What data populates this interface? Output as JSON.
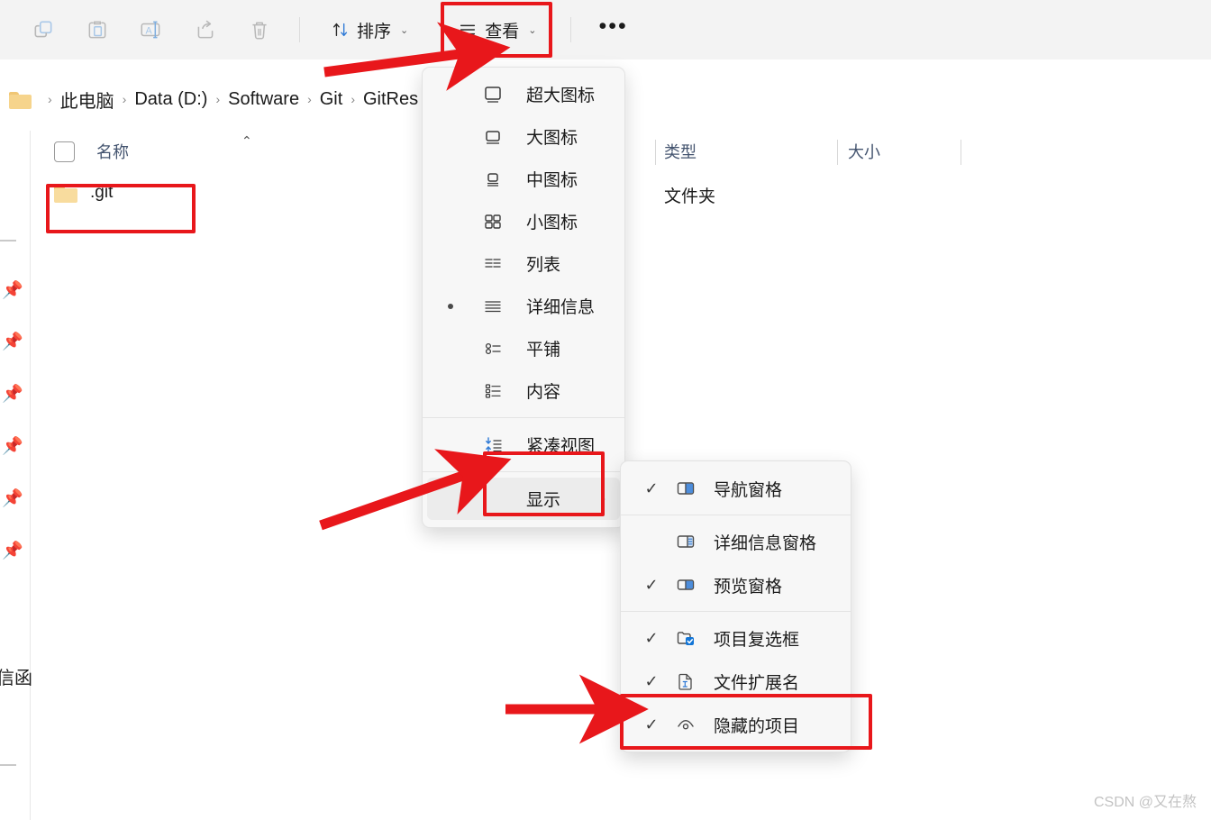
{
  "toolbar": {
    "icons": [
      {
        "name": "copy-icon",
        "glyph": "copy"
      },
      {
        "name": "paste-icon",
        "glyph": "paste"
      },
      {
        "name": "rename-icon",
        "glyph": "rename"
      },
      {
        "name": "share-icon",
        "glyph": "share"
      },
      {
        "name": "delete-icon",
        "glyph": "trash"
      }
    ],
    "sort_label": "排序",
    "view_label": "查看",
    "more_label": "•••",
    "chevron": "⌄"
  },
  "breadcrumb": {
    "separator": "›",
    "items": [
      "此电脑",
      "Data (D:)",
      "Software",
      "Git",
      "GitRes"
    ]
  },
  "columns": {
    "name": "名称",
    "type": "类型",
    "size": "大小",
    "sort_caret": "⌃"
  },
  "files": [
    {
      "name": ".git",
      "type": "文件夹",
      "size": ""
    }
  ],
  "view_menu": {
    "items": [
      {
        "label": "超大图标",
        "icon": "extra-large-icons-icon",
        "selected": false
      },
      {
        "label": "大图标",
        "icon": "large-icons-icon",
        "selected": false
      },
      {
        "label": "中图标",
        "icon": "medium-icons-icon",
        "selected": false
      },
      {
        "label": "小图标",
        "icon": "small-icons-icon",
        "selected": false
      },
      {
        "label": "列表",
        "icon": "list-icon",
        "selected": false
      },
      {
        "label": "详细信息",
        "icon": "details-icon",
        "selected": true
      },
      {
        "label": "平铺",
        "icon": "tiles-icon",
        "selected": false
      },
      {
        "label": "内容",
        "icon": "content-icon",
        "selected": false
      }
    ],
    "compact_label": "紧凑视图",
    "compact_icon": "compact-view-icon",
    "show_label": "显示",
    "show_chevron": "›"
  },
  "display_submenu": {
    "groups": [
      [
        {
          "label": "导航窗格",
          "icon": "navigation-pane-icon",
          "checked": true
        },
        {
          "label": "详细信息窗格",
          "icon": "details-pane-icon",
          "checked": false
        },
        {
          "label": "预览窗格",
          "icon": "preview-pane-icon",
          "checked": true
        }
      ],
      [
        {
          "label": "项目复选框",
          "icon": "item-checkboxes-icon",
          "checked": true
        },
        {
          "label": "文件扩展名",
          "icon": "file-extensions-icon",
          "checked": true
        },
        {
          "label": "隐藏的项目",
          "icon": "hidden-items-icon",
          "checked": true
        }
      ]
    ],
    "check_glyph": "✓"
  },
  "sidebar": {
    "pin_count": 6,
    "pin_icon": "pin-icon",
    "cut_text": "信函"
  },
  "watermark": "CSDN @又在熬",
  "colors": {
    "accent_red": "#e8171b",
    "toolbar_bg": "#f3f3f3",
    "menu_bg": "#f7f7f7",
    "header_text": "#44546f",
    "blue_accent": "#0f6cbd"
  }
}
